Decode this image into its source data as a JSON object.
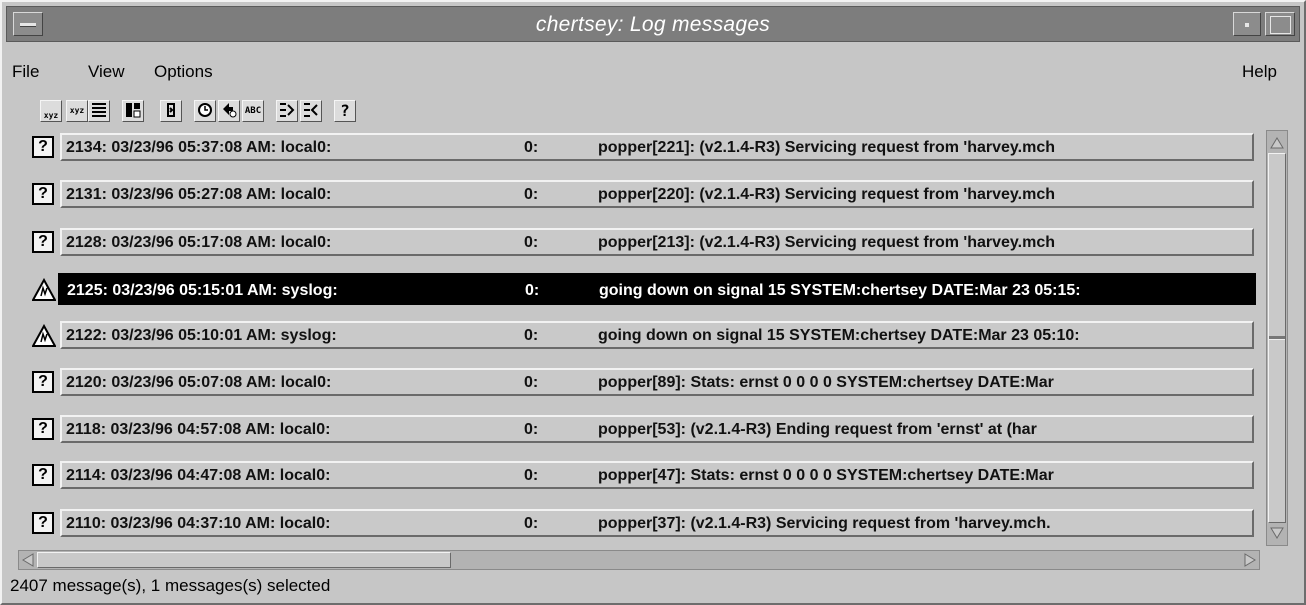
{
  "window": {
    "title": "chertsey: Log messages"
  },
  "menubar": {
    "items": [
      {
        "label": "File"
      },
      {
        "label": "View"
      },
      {
        "label": "Options"
      },
      {
        "label": "Help"
      }
    ]
  },
  "toolbar": {
    "buttons": [
      {
        "icon": "xyz-grid-icon",
        "label": "xyz"
      },
      {
        "icon": "xyz-flat-icon",
        "label": "xyz"
      },
      {
        "icon": "list-view-icon",
        "label": ""
      },
      {
        "icon": "columns-icon",
        "label": ""
      },
      {
        "icon": "page-flip-icon",
        "label": ""
      },
      {
        "icon": "clock-icon",
        "label": ""
      },
      {
        "icon": "arrow-clock-icon",
        "label": ""
      },
      {
        "icon": "abc-icon",
        "label": "ABC"
      },
      {
        "icon": "wrap-left-icon",
        "label": ""
      },
      {
        "icon": "wrap-right-icon",
        "label": ""
      },
      {
        "icon": "help-icon",
        "label": "?"
      }
    ]
  },
  "log": {
    "rows": [
      {
        "icon": "question-icon",
        "header": "2134: 03/23/96 05:37:08 AM: local0:",
        "priority": "0:",
        "message": "popper[221]: (v2.1.4-R3) Servicing request from 'harvey.mch",
        "selected": false
      },
      {
        "icon": "question-icon",
        "header": "2131: 03/23/96 05:27:08 AM: local0:",
        "priority": "0:",
        "message": "popper[220]: (v2.1.4-R3) Servicing request from 'harvey.mch",
        "selected": false
      },
      {
        "icon": "question-icon",
        "header": "2128: 03/23/96 05:17:08 AM: local0:",
        "priority": "0:",
        "message": "popper[213]: (v2.1.4-R3) Servicing request from 'harvey.mch",
        "selected": false
      },
      {
        "icon": "warning-icon",
        "header": "2125: 03/23/96 05:15:01 AM: syslog:",
        "priority": "0:",
        "message": "going down on signal 15 SYSTEM:chertsey  DATE:Mar 23 05:15:",
        "selected": true
      },
      {
        "icon": "warning-icon",
        "header": "2122: 03/23/96 05:10:01 AM: syslog:",
        "priority": "0:",
        "message": "going down on signal 15 SYSTEM:chertsey  DATE:Mar 23 05:10:",
        "selected": false
      },
      {
        "icon": "question-icon",
        "header": "2120: 03/23/96 05:07:08 AM: local0:",
        "priority": "0:",
        "message": "popper[89]: Stats: ernst 0 0 0 0 SYSTEM:chertsey  DATE:Mar",
        "selected": false
      },
      {
        "icon": "question-icon",
        "header": "2118: 03/23/96 04:57:08 AM: local0:",
        "priority": "0:",
        "message": "popper[53]: (v2.1.4-R3) Ending request from 'ernst' at (har",
        "selected": false
      },
      {
        "icon": "question-icon",
        "header": "2114: 03/23/96 04:47:08 AM: local0:",
        "priority": "0:",
        "message": "popper[47]: Stats: ernst 0 0 0 0 SYSTEM:chertsey  DATE:Mar",
        "selected": false
      },
      {
        "icon": "question-icon",
        "header": "2110: 03/23/96 04:37:10 AM: local0:",
        "priority": "0:",
        "message": "popper[37]: (v2.1.4-R3) Servicing request from 'harvey.mch.",
        "selected": false
      }
    ]
  },
  "status": {
    "text": "2407 message(s), 1 messages(s) selected"
  }
}
